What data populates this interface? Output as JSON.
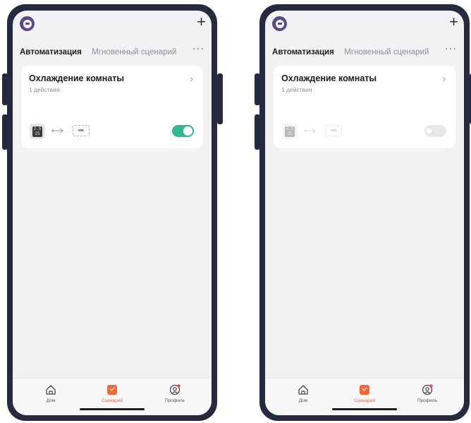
{
  "screens": [
    {
      "tabs": [
        "Автоматизация",
        "Мгновенный сценарий"
      ],
      "more": "···",
      "plus": "+",
      "card": {
        "title": "Охлаждение комнаты",
        "subtitle": "1 действия",
        "chevron": "›",
        "lcd": "2.5\n25",
        "toggle_on": true
      },
      "nav": [
        "Дом",
        "Сценарий",
        "Профиль"
      ]
    },
    {
      "tabs": [
        "Автоматизация",
        "Мгновенный сценарий"
      ],
      "more": "···",
      "plus": "+",
      "card": {
        "title": "Охлаждение комнаты",
        "subtitle": "1 действия",
        "chevron": "›",
        "lcd": "2.5\n25",
        "toggle_on": false
      },
      "nav": [
        "Дом",
        "Сценарий",
        "Профиль"
      ]
    }
  ],
  "colors": {
    "accent": "#2fb892",
    "nav_active": "#e9663a",
    "frame": "#262a3e"
  }
}
